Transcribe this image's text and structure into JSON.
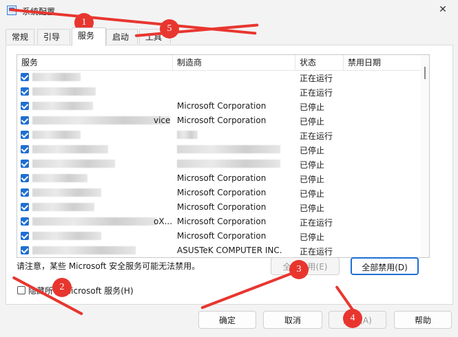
{
  "window": {
    "title": "系统配置",
    "close_glyph": "✕"
  },
  "tabs": [
    {
      "label": "常规"
    },
    {
      "label": "引导"
    },
    {
      "label": "服务",
      "active": true
    },
    {
      "label": "启动"
    },
    {
      "label": "工具"
    }
  ],
  "table": {
    "headers": [
      "服务",
      "制造商",
      "状态",
      "禁用日期"
    ],
    "rows": [
      {
        "service_tail": "",
        "manufacturer": "",
        "status": "正在运行"
      },
      {
        "service_tail": "",
        "manufacturer": "",
        "status": "正在运行"
      },
      {
        "service_tail": "",
        "manufacturer": "Microsoft Corporation",
        "status": "已停止"
      },
      {
        "service_tail": "vice",
        "manufacturer": "Microsoft Corporation",
        "status": "已停止"
      },
      {
        "service_tail": "",
        "manufacturer": "",
        "status": "正在运行"
      },
      {
        "service_tail": "",
        "manufacturer": "",
        "status": "已停止"
      },
      {
        "service_tail": "",
        "manufacturer": "",
        "status": "已停止"
      },
      {
        "service_tail": "",
        "manufacturer": "Microsoft Corporation",
        "status": "已停止"
      },
      {
        "service_tail": "",
        "manufacturer": "Microsoft Corporation",
        "status": "已停止"
      },
      {
        "service_tail": "",
        "manufacturer": "Microsoft Corporation",
        "status": "已停止"
      },
      {
        "service_tail": "oX...",
        "manufacturer": "Microsoft Corporation",
        "status": "正在运行"
      },
      {
        "service_tail": "",
        "manufacturer": "Microsoft Corporation",
        "status": "已停止"
      },
      {
        "service_tail": "",
        "manufacturer": "ASUSTeK COMPUTER INC.",
        "status": "正在运行"
      }
    ]
  },
  "notice": "请注意，某些 Microsoft 安全服务可能无法禁用。",
  "buttons": {
    "enable_all": "全部启用(E)",
    "disable_all": "全部禁用(D)",
    "ok": "确定",
    "cancel": "取消",
    "apply": "应用(A)",
    "help": "帮助"
  },
  "hide_ms": {
    "label": "隐藏所有 Microsoft 服务(H)"
  },
  "annotations": [
    "1",
    "2",
    "3",
    "4",
    "5"
  ],
  "colors": {
    "accent": "#1f6fd1",
    "annotation": "#e8362f"
  }
}
